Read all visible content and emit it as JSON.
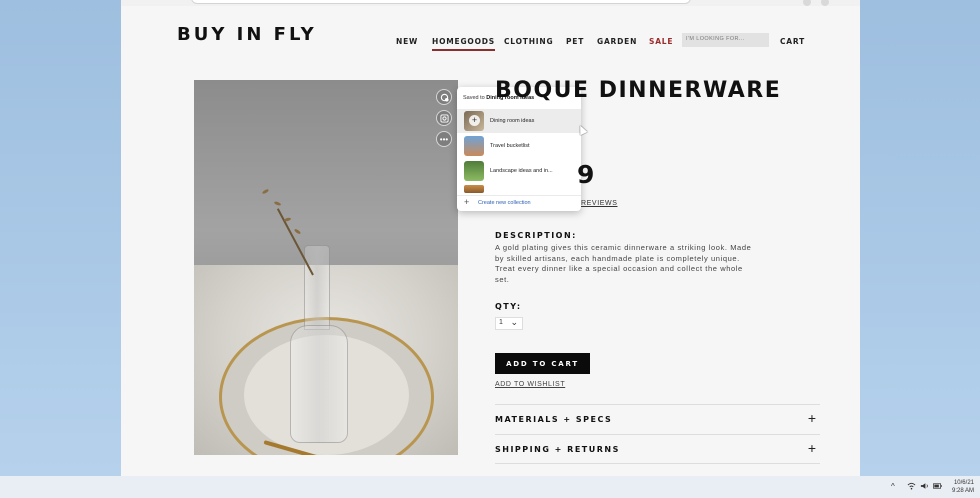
{
  "store": {
    "logo": "BUY IN FLY",
    "nav": [
      "NEW",
      "HOMEGOODS",
      "CLOTHING",
      "PET",
      "GARDEN",
      "SALE"
    ],
    "search_placeholder": "I'M LOOKING FOR...",
    "cart_label": "CART"
  },
  "collections_popup": {
    "saved_prefix": "Saved to",
    "saved_collection": "Dining room ideas",
    "items": [
      "Dining room ideas",
      "Travel bucketlist",
      "Landscape ideas and in..."
    ],
    "create_label": "Create new collection"
  },
  "product": {
    "title_visible": "BOQUE DINNERWARE",
    "price_visible": "9",
    "reviews_visible": "REVIEWS",
    "description_label": "DESCRIPTION:",
    "description": "A gold plating gives this ceramic dinnerware a striking look. Made by skilled artisans, each handmade plate is completely unique. Treat every dinner like a special occasion and collect the whole set.",
    "qty_label": "QTY:",
    "qty_value": "1",
    "add_to_cart": "ADD TO CART",
    "wishlist": "ADD TO WISHLIST",
    "accordions": [
      "MATERIALS + SPECS",
      "SHIPPING + RETURNS"
    ]
  },
  "taskbar": {
    "date": "10/6/21",
    "time": "9:28 AM"
  },
  "colors": {
    "accent_underline": "#8b2e2e",
    "sale": "#9b2b2b",
    "button_bg": "#0b0b0b",
    "link": "#2b5fb5"
  }
}
